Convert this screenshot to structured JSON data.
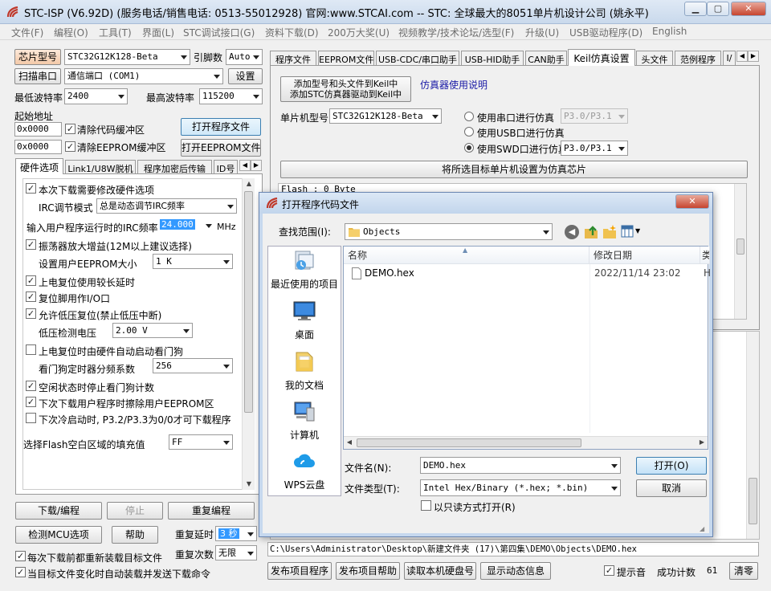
{
  "titlebar": {
    "title": "STC-ISP (V6.92D) (服务电话/销售电话: 0513-55012928) 官网:www.STCAI.com  -- STC: 全球最大的8051单片机设计公司 (姚永平)"
  },
  "menu": [
    "文件(F)",
    "编程(O)",
    "工具(T)",
    "界面(L)",
    "STC调试接口(G)",
    "资料下载(D)",
    "200万大奖(U)",
    "视频教学/技术论坛/选型(F)",
    "升级(U)",
    "USB驱动程序(D)",
    "English"
  ],
  "left": {
    "chip_btn": "芯片型号",
    "chip_value": "STC32G12K128-Beta",
    "pin_label": "引脚数",
    "pin_value": "Auto",
    "scan_btn": "扫描串口",
    "port_value": "通信端口 (COM1)",
    "settings_btn": "设置",
    "min_baud_label": "最低波特率",
    "min_baud": "2400",
    "max_baud_label": "最高波特率",
    "max_baud": "115200",
    "start_addr_label": "起始地址",
    "addr1": "0x0000",
    "clear_code": "清除代码缓冲区",
    "open_prog_btn": "打开程序文件",
    "addr2": "0x0000",
    "clear_eeprom": "清除EEPROM缓冲区",
    "open_eeprom_btn": "打开EEPROM文件",
    "tabs": [
      "硬件选项",
      "Link1/U8W脱机",
      "程序加密后传输",
      "ID号"
    ],
    "hw": {
      "opt1": "本次下载需要修改硬件选项",
      "irc_mode_label": "IRC调节模式",
      "irc_mode": "总是动态调节IRC频率",
      "irc_freq_label": "输入用户程序运行时的IRC频率",
      "irc_freq": "24.000",
      "irc_unit": "MHz",
      "opt2": "振荡器放大增益(12M以上建议选择)",
      "eeprom_label": "设置用户EEPROM大小",
      "eeprom_value": "1   K",
      "opt3": "上电复位使用较长延时",
      "opt4": "复位脚用作I/O口",
      "opt5": "允许低压复位(禁止低压中断)",
      "lvd_label": "低压检测电压",
      "lvd_value": "2.00 V",
      "opt6": "上电复位时由硬件自动启动看门狗",
      "wdt_label": "看门狗定时器分频系数",
      "wdt_value": "256",
      "opt7": "空闲状态时停止看门狗计数",
      "opt8": "下次下载用户程序时擦除用户EEPROM区",
      "opt9": "下次冷启动时, P3.2/P3.3为0/0才可下载程序",
      "fill_label": "选择Flash空白区域的填充值",
      "fill_value": "FF"
    },
    "download_btn": "下载/编程",
    "stop_btn": "停止",
    "redo_btn": "重复编程",
    "detect_btn": "检测MCU选项",
    "help_btn": "帮助",
    "delay_label": "重复延时",
    "delay_value": "3 秒",
    "count_label": "重复次数",
    "count_value": "无限",
    "reload_label": "每次下载前都重新装载目标文件",
    "autosend_label": "当目标文件变化时自动装载并发送下载命令"
  },
  "right": {
    "tabs": [
      "程序文件",
      "EEPROM文件",
      "USB-CDC/串口助手",
      "USB-HID助手",
      "CAN助手",
      "Keil仿真设置",
      "头文件",
      "范例程序",
      "I/"
    ],
    "keil_btn_line1": "添加型号和头文件到Keil中",
    "keil_btn_line2": "添加STC仿真器驱动到Keil中",
    "sim_help": "仿真器使用说明",
    "mcu_label": "单片机型号",
    "mcu_value": "STC32G12K128-Beta",
    "r1": "使用串口进行仿真",
    "r1_value": "P3.0/P3.1",
    "r2": "使用USB口进行仿真",
    "r3": "使用SWD口进行仿真",
    "r3_value": "P3.0/P3.1",
    "set_chip_btn": "将所选目标单片机设置为仿真芯片",
    "flash_info": "Flash : 0 Byte",
    "path": "C:\\Users\\Administrator\\Desktop\\新建文件夹 (17)\\第四集\\DEMO\\Objects\\DEMO.hex",
    "publish_btn": "发布项目程序",
    "publish_help_btn": "发布项目帮助",
    "read_disk_btn": "读取本机硬盘号",
    "show_dyn_btn": "显示动态信息",
    "beep_label": "提示音",
    "success_label": "成功计数",
    "success_value": "61",
    "clear_btn": "清零"
  },
  "dialog": {
    "title": "打开程序代码文件",
    "lookin_label": "查找范围(I):",
    "lookin_value": "Objects",
    "places": [
      "最近使用的项目",
      "桌面",
      "我的文档",
      "计算机",
      "WPS云盘"
    ],
    "col_name": "名称",
    "col_date": "修改日期",
    "col_more": "类",
    "files": [
      {
        "name": "DEMO.hex",
        "date": "2022/11/14 23:02",
        "type": "H"
      }
    ],
    "filename_label": "文件名(N):",
    "filename_value": "DEMO.hex",
    "filetype_label": "文件类型(T):",
    "filetype_value": "Intel Hex/Binary (*.hex; *.bin)",
    "readonly_label": "以只读方式打开(R)",
    "open_btn": "打开(O)",
    "cancel_btn": "取消"
  }
}
